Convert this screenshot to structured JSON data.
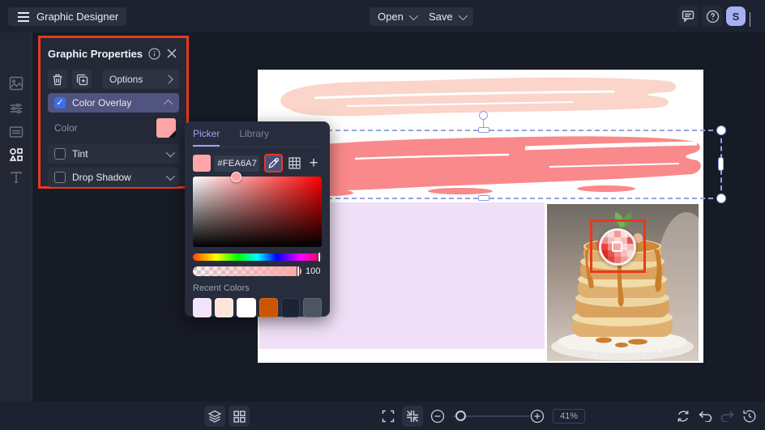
{
  "topbar": {
    "app_title": "Graphic Designer",
    "open_label": "Open",
    "save_label": "Save",
    "avatar_initial": "S"
  },
  "sidebar": {
    "items": [
      {
        "name": "image-icon"
      },
      {
        "name": "edit-sliders-icon"
      },
      {
        "name": "templates-icon"
      },
      {
        "name": "graphics-shapes-icon",
        "active": true
      },
      {
        "name": "text-icon"
      }
    ]
  },
  "properties_panel": {
    "title": "Graphic Properties",
    "options_label": "Options",
    "color_overlay_label": "Color Overlay",
    "color_overlay_checked": true,
    "color_label": "Color",
    "tint_label": "Tint",
    "drop_shadow_label": "Drop Shadow",
    "check_glyph": "✓"
  },
  "color_picker": {
    "picker_tab": "Picker",
    "library_tab": "Library",
    "hex_value": "#FEA6A7",
    "opacity_value": "100",
    "recent_colors_label": "Recent Colors",
    "recent_colors": [
      "#F2E3FC",
      "#FBE6D9",
      "#FFFFFF",
      "#CC5502",
      "#1B2336",
      "#4C5564"
    ],
    "current_color": "#FEA6A7",
    "plus_glyph": "+"
  },
  "footer": {
    "zoom_value": "41%"
  },
  "colors": {
    "annotation_red": "#E8391B",
    "selection_blue": "#96A2DF",
    "avatar_bg": "#A9AFF4",
    "swatch_pink": "#FCA6A7",
    "stroke_peach": "#FBD4CA",
    "stroke_salmon": "#F9898B",
    "lavender_block": "#EFE0F7",
    "overlay_row_bg": "#50547E",
    "checkbox_blue": "#3D6DEB"
  }
}
